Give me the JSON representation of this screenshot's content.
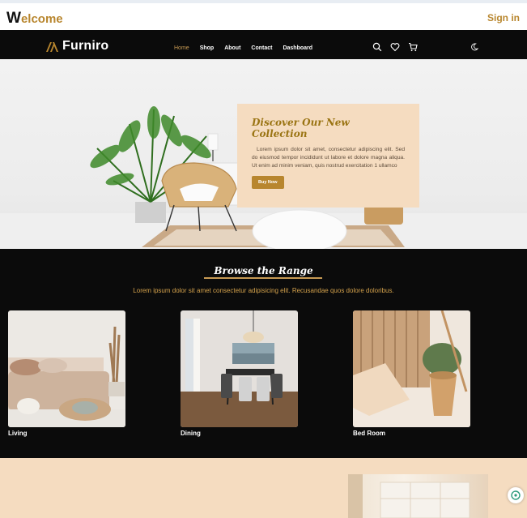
{
  "welcome": {
    "first_letter": "W",
    "rest": "elcome"
  },
  "signin_label": "Sign in",
  "brand": {
    "name": "Furniro",
    "accent": "#b8862e",
    "peach": "#f5dcc0",
    "dark": "#0b0b0b"
  },
  "nav": {
    "items": [
      {
        "label": "Home",
        "active": true
      },
      {
        "label": "Shop"
      },
      {
        "label": "About"
      },
      {
        "label": "Contact"
      },
      {
        "label": "Dashboard"
      }
    ],
    "icons": [
      "search-icon",
      "heart-icon",
      "cart-icon",
      "moon-icon"
    ]
  },
  "hero": {
    "title": "Discover Our New Collection",
    "text": "Lorem ipsum dolor sit amet, consectetur adipiscing elit. Sed do eiusmod tempor incididunt ut labore et dolore magna aliqua. Ut enim ad minim veniam, quis nostrud exercitation 1 ullamco",
    "button": "Buy Now"
  },
  "browse": {
    "title": "Browse the Range",
    "subtitle": "Lorem ipsum dolor sit amet consectetur adipisicing elit. Recusandae quos dolore doloribus.",
    "items": [
      {
        "label": "Living"
      },
      {
        "label": "Dining"
      },
      {
        "label": "Bed Room"
      }
    ]
  }
}
